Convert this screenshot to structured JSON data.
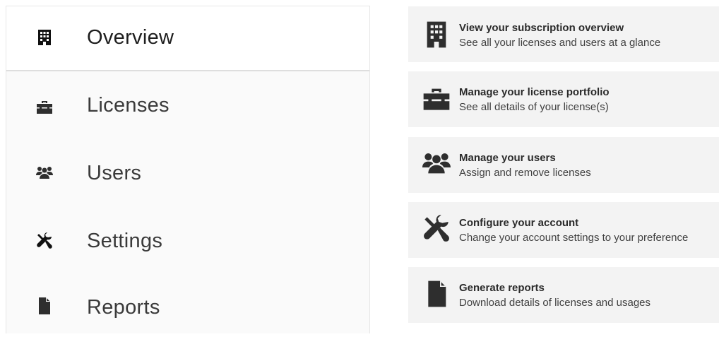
{
  "sidebar": {
    "items": [
      {
        "label": "Overview",
        "icon": "building-icon",
        "active": true
      },
      {
        "label": "Licenses",
        "icon": "briefcase-icon",
        "active": false
      },
      {
        "label": "Users",
        "icon": "users-icon",
        "active": false
      },
      {
        "label": "Settings",
        "icon": "tools-icon",
        "active": false
      },
      {
        "label": "Reports",
        "icon": "file-icon",
        "active": false
      }
    ]
  },
  "cards": [
    {
      "title": "View your subscription overview",
      "description": "See all your licenses and users at a glance",
      "icon": "building-icon"
    },
    {
      "title": "Manage your license portfolio",
      "description": "See all details of your license(s)",
      "icon": "briefcase-icon"
    },
    {
      "title": "Manage your users",
      "description": "Assign and remove licenses",
      "icon": "users-icon"
    },
    {
      "title": "Configure your account",
      "description": "Change your account settings to your preference",
      "icon": "tools-icon"
    },
    {
      "title": "Generate reports",
      "description": "Download details of licenses and usages",
      "icon": "file-icon"
    }
  ],
  "colors": {
    "icon": "#2e2e2e",
    "card_background": "#f3f3f3",
    "sidebar_background": "#fafafa"
  }
}
